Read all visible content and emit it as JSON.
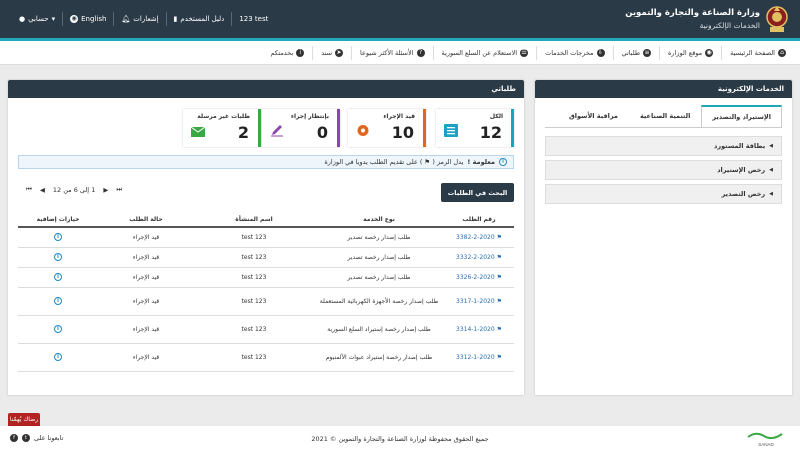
{
  "header": {
    "ministry": "وزارة الصناعة والتجارة والتموين",
    "subtitle": "الخدمات الإلكترونية",
    "links": [
      {
        "label": "123 test",
        "icon": ""
      },
      {
        "label": "دليل المستخدم",
        "icon": "book-icon"
      },
      {
        "label": "إشعارات",
        "icon": "bell-icon"
      },
      {
        "label": "English",
        "icon": "globe-icon"
      },
      {
        "label": "حسابي",
        "icon": "user-icon"
      }
    ]
  },
  "nav": [
    {
      "label": "الصفحة الرئيسية",
      "icon": "home-icon",
      "glyph": "⌂"
    },
    {
      "label": "موقع الوزارة",
      "icon": "globe-icon",
      "glyph": "◉"
    },
    {
      "label": "طلباتي",
      "icon": "list-icon",
      "glyph": "≡"
    },
    {
      "label": "مخرجات الخدمات",
      "icon": "output-icon",
      "glyph": "⇩"
    },
    {
      "label": "الاستعلام عن السلع السورية",
      "icon": "search-list-icon",
      "glyph": "☰"
    },
    {
      "label": "الأسئلة الأكثر شيوعا",
      "icon": "question-icon",
      "glyph": "?"
    },
    {
      "label": "سند",
      "icon": "send-icon",
      "glyph": "➤"
    },
    {
      "label": "بخدمتكم",
      "icon": "info-icon",
      "glyph": "i"
    }
  ],
  "services": {
    "title": "الخدمات الإلكترونية",
    "tabs": [
      "الإستيراد والتصدير",
      "التنمية الصناعية",
      "مراقبة الأسواق"
    ],
    "items": [
      "بطاقة المستورد",
      "رخص الإستيراد",
      "رخص التصدير"
    ]
  },
  "requests": {
    "title": "طلباتي",
    "cards": [
      {
        "label": "الكل",
        "value": "12",
        "icon": "list-icon"
      },
      {
        "label": "قيد الإجراء",
        "value": "10",
        "icon": "gear-icon"
      },
      {
        "label": "بإنتظار إجراء",
        "value": "0",
        "icon": "pencil-icon"
      },
      {
        "label": "طلبات غير مرسلة",
        "value": "2",
        "icon": "mail-icon"
      }
    ],
    "notice_bold": "معلومة !",
    "notice_text": "يدل الرمز ( ⚑ ) على تقديم الطلب يدويا في الوزارة",
    "pager": "1 إلى 6 من 12",
    "search_button": "البحث في الطلبات",
    "columns": [
      "رقم الطلب",
      "نوع الخدمة",
      "اسم المنشأة",
      "حالة الطلب",
      "خيارات إضافية"
    ],
    "rows": [
      {
        "id": "3382-2-2020",
        "service": "طلب إصدار رخصة تصدير",
        "org": "test 123",
        "status": "قيد الإجراء"
      },
      {
        "id": "3332-2-2020",
        "service": "طلب إصدار رخصة تصدير",
        "org": "test 123",
        "status": "قيد الإجراء"
      },
      {
        "id": "3326-2-2020",
        "service": "طلب إصدار رخصة تصدير",
        "org": "test 123",
        "status": "قيد الإجراء"
      },
      {
        "id": "3317-1-2020",
        "service": "طلب إصدار رخصة الأجهزة الكهربائية المستعملة",
        "org": "test 123",
        "status": "قيد الإجراء"
      },
      {
        "id": "3314-1-2020",
        "service": "طلب إصدار رخصة إستيراد السلع السورية",
        "org": "test 123",
        "status": "قيد الإجراء"
      },
      {
        "id": "3312-1-2020",
        "service": "طلب إصدار رخصة إستيراد عبوات الألمنيوم",
        "org": "test 123",
        "status": "قيد الإجراء"
      }
    ]
  },
  "footer": {
    "feedback": "رضاك يُهمّنا",
    "copyright": "جميع الحقوق محفوظة لوزارة الصناعة والتجارة والتموين © 2021",
    "follow": "تابعونا على",
    "sanad": "SANAD"
  },
  "colors": {
    "header": "#2b3a47",
    "accent": "#20a8b8",
    "link": "#2a6fb4"
  }
}
